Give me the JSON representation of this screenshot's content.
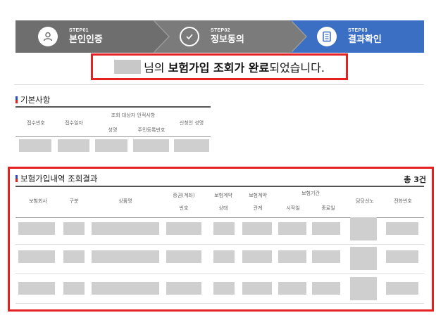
{
  "steps": [
    {
      "num": "STEP01",
      "label": "본인인증",
      "icon": "person-icon"
    },
    {
      "num": "STEP02",
      "label": "정보동의",
      "icon": "check-circle-icon"
    },
    {
      "num": "STEP03",
      "label": "결과확인",
      "icon": "document-icon"
    }
  ],
  "headline": {
    "suffix": "님의",
    "bold1": "보험가입 조회가 완료",
    "rest": "되었습니다."
  },
  "basic": {
    "title": "기본사항",
    "headers": {
      "receipt_no": "접수번호",
      "receipt_date": "접수일자",
      "target_group": "조회 대상자 인적사항",
      "name": "성명",
      "id_no": "주민등록번호",
      "applicant": "신청인 성명"
    }
  },
  "result": {
    "title": "보험가입내역 조회결과",
    "count": "총 3건",
    "headers": {
      "company": "보험회사",
      "type": "구분",
      "product": "상품명",
      "policy_no_1": "증권(계좌)",
      "policy_no_2": "번호",
      "status_1": "보험계약",
      "status_2": "상태",
      "relation_1": "보험계약",
      "relation_2": "관계",
      "period": "보험기간",
      "start": "시작일",
      "end": "종료일",
      "manager": "담당선노",
      "phone": "전화번호"
    },
    "rows": 3
  },
  "colors": {
    "step_active": "#3b6fc4",
    "step_inactive": "#6e6e6e",
    "highlight": "#e42020",
    "mask": "#cfcfcf"
  }
}
